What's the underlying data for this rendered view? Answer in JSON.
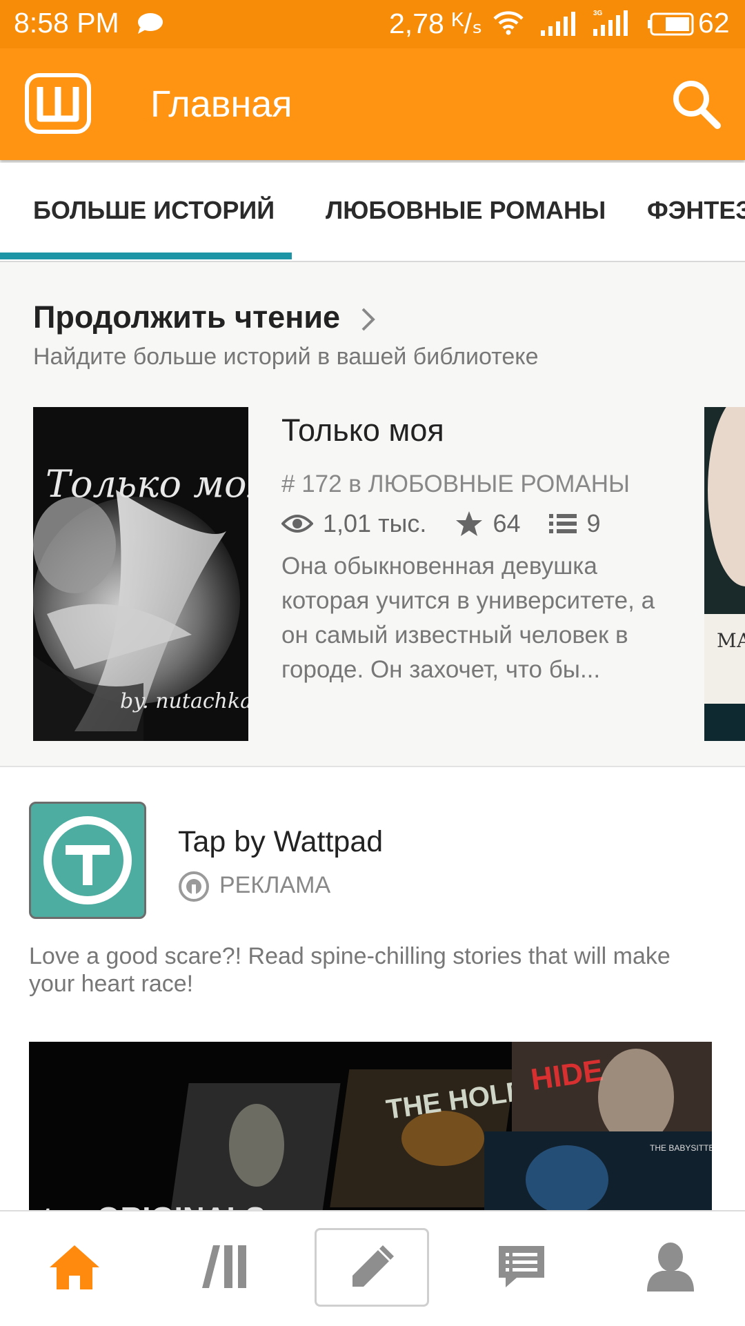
{
  "status_bar": {
    "time": "8:58 PM",
    "speed": "2,78 ᴷ/ₛ",
    "battery": "62"
  },
  "app_bar": {
    "title": "Главная"
  },
  "tabs": [
    {
      "label": "БОЛЬШЕ ИСТОРИЙ",
      "active": true
    },
    {
      "label": "ЛЮБОВНЫЕ РОМАНЫ",
      "active": false
    },
    {
      "label": "ФЭНТЕЗИ",
      "active": false
    }
  ],
  "continue_reading": {
    "title": "Продолжить чтение",
    "subtitle": "Найдите больше историй в вашей библиотеке",
    "story": {
      "cover_title": "Только моя",
      "cover_author": "by. nutachkal",
      "title": "Только моя",
      "rank": "# 172 в ЛЮБОВНЫЕ РОМАНЫ",
      "views": "1,01 тыс.",
      "votes": "64",
      "parts": "9",
      "description": "Она обыкновенная девушка которая учится в университете, а он самый известный человек в городе. Он захочет, что  бы..."
    },
    "next_cover_text": "МА ДИ"
  },
  "ad": {
    "name": "Tap by Wattpad",
    "label": "РЕКЛАМА",
    "text": "Love a good scare?! Read spine-chilling stories that will make your heart race!",
    "banner_titles": [
      "THE HOLE",
      "HIDE",
      "THE BABYSITTER"
    ],
    "banner_footer": "tap ORIGINALS"
  },
  "colors": {
    "status_bar": "#f78c09",
    "app_bar": "#ff9412",
    "tab_indicator": "#1e95a6",
    "nav_active": "#ff8a0e",
    "nav_inactive": "#8e8e8e",
    "ad_icon_bg": "#4dada0"
  },
  "bottom_nav": [
    {
      "icon": "home-icon",
      "active": true
    },
    {
      "icon": "library-icon",
      "active": false
    },
    {
      "icon": "pencil-icon",
      "active": false
    },
    {
      "icon": "messages-icon",
      "active": false
    },
    {
      "icon": "profile-icon",
      "active": false
    }
  ]
}
